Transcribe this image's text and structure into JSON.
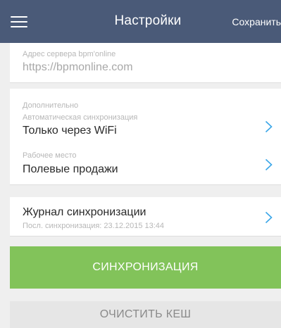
{
  "header": {
    "title": "Настройки",
    "save_label": "Сохранить",
    "menu_icon": "hamburger-menu-icon",
    "background_color": "#4a5a78"
  },
  "server": {
    "label": "Адрес сервера bpm'online",
    "placeholder": "https://bpmonline.com"
  },
  "extra": {
    "section_label": "Дополнительно",
    "auto_sync_label": "Автоматическая синхронизация",
    "auto_sync_value": "Только через WiFi",
    "workplace_label": "Рабочее место",
    "workplace_value": "Полевые продажи"
  },
  "sync_log": {
    "title": "Журнал синхронизации",
    "last_sync": "Посл. синхронизация: 23.12.2015 13:44"
  },
  "actions": {
    "sync_label": "СИНХРОНИЗАЦИЯ",
    "clear_cache_label": "ОЧИСТИТЬ КЕШ"
  },
  "colors": {
    "accent_chevron": "#3aa6e8",
    "sync_button": "#82c35a",
    "clear_button": "#e6e6e6"
  }
}
